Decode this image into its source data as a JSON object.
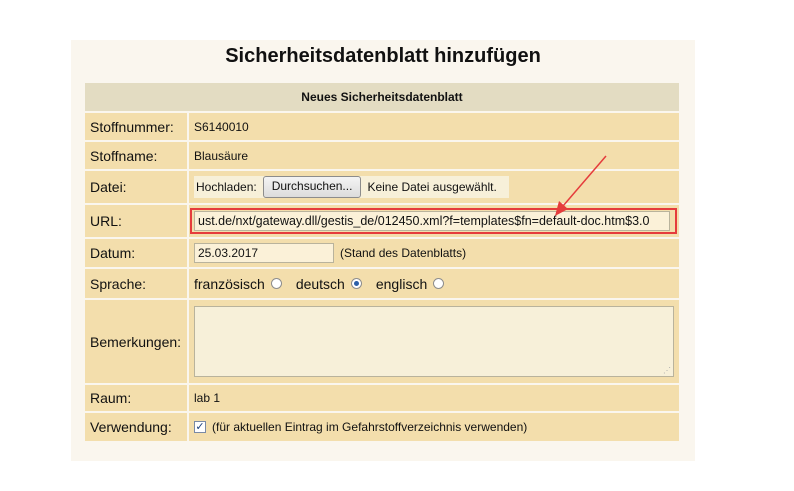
{
  "page_title": "Sicherheitsdatenblatt hinzufügen",
  "section_header": "Neues Sicherheitsdatenblatt",
  "fields": {
    "stoffnummer": {
      "label": "Stoffnummer:",
      "value": "S6140010"
    },
    "stoffname": {
      "label": "Stoffname:",
      "value": "Blausäure"
    },
    "datei": {
      "label": "Datei:",
      "upload_label": "Hochladen:",
      "button": "Durchsuchen...",
      "status": "Keine Datei ausgewählt."
    },
    "url": {
      "label": "URL:",
      "value": "ust.de/nxt/gateway.dll/gestis_de/012450.xml?f=templates$fn=default-doc.htm$3.0"
    },
    "datum": {
      "label": "Datum:",
      "value": "25.03.2017",
      "hint": "(Stand des Datenblatts)"
    },
    "sprache": {
      "label": "Sprache:",
      "options": [
        "französisch",
        "deutsch",
        "englisch"
      ],
      "selected": "deutsch"
    },
    "bemerkungen": {
      "label": "Bemerkungen:",
      "value": ""
    },
    "raum": {
      "label": "Raum:",
      "value": "lab 1"
    },
    "verwendung": {
      "label": "Verwendung:",
      "checked": true,
      "text": "(für aktuellen Eintrag im Gefahrstoffverzeichnis verwenden)"
    }
  },
  "colors": {
    "highlight": "#e53c3c",
    "row_bg": "#f3deac",
    "header_bg": "#e3dcc2"
  }
}
